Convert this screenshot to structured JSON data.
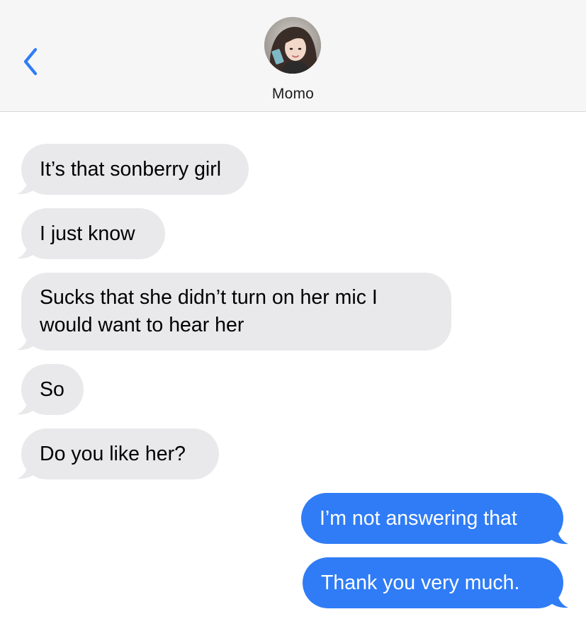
{
  "header": {
    "contact_name": "Momo",
    "back_icon": "chevron-left-icon",
    "avatar_icon": "contact-photo"
  },
  "colors": {
    "header_bg": "#f6f6f6",
    "incoming_bubble": "#e9e9eb",
    "outgoing_bubble": "#2f7cf6",
    "accent": "#2f7cf6"
  },
  "messages": [
    {
      "direction": "incoming",
      "text": "It’s that sonberry girl"
    },
    {
      "direction": "incoming",
      "text": "I just know"
    },
    {
      "direction": "incoming",
      "text": "Sucks that she didn’t turn on her mic I would want to hear her"
    },
    {
      "direction": "incoming",
      "text": "So"
    },
    {
      "direction": "incoming",
      "text": "Do you like her?"
    },
    {
      "direction": "outgoing",
      "text": "I’m not answering that"
    },
    {
      "direction": "outgoing",
      "text": "Thank you very much."
    }
  ]
}
